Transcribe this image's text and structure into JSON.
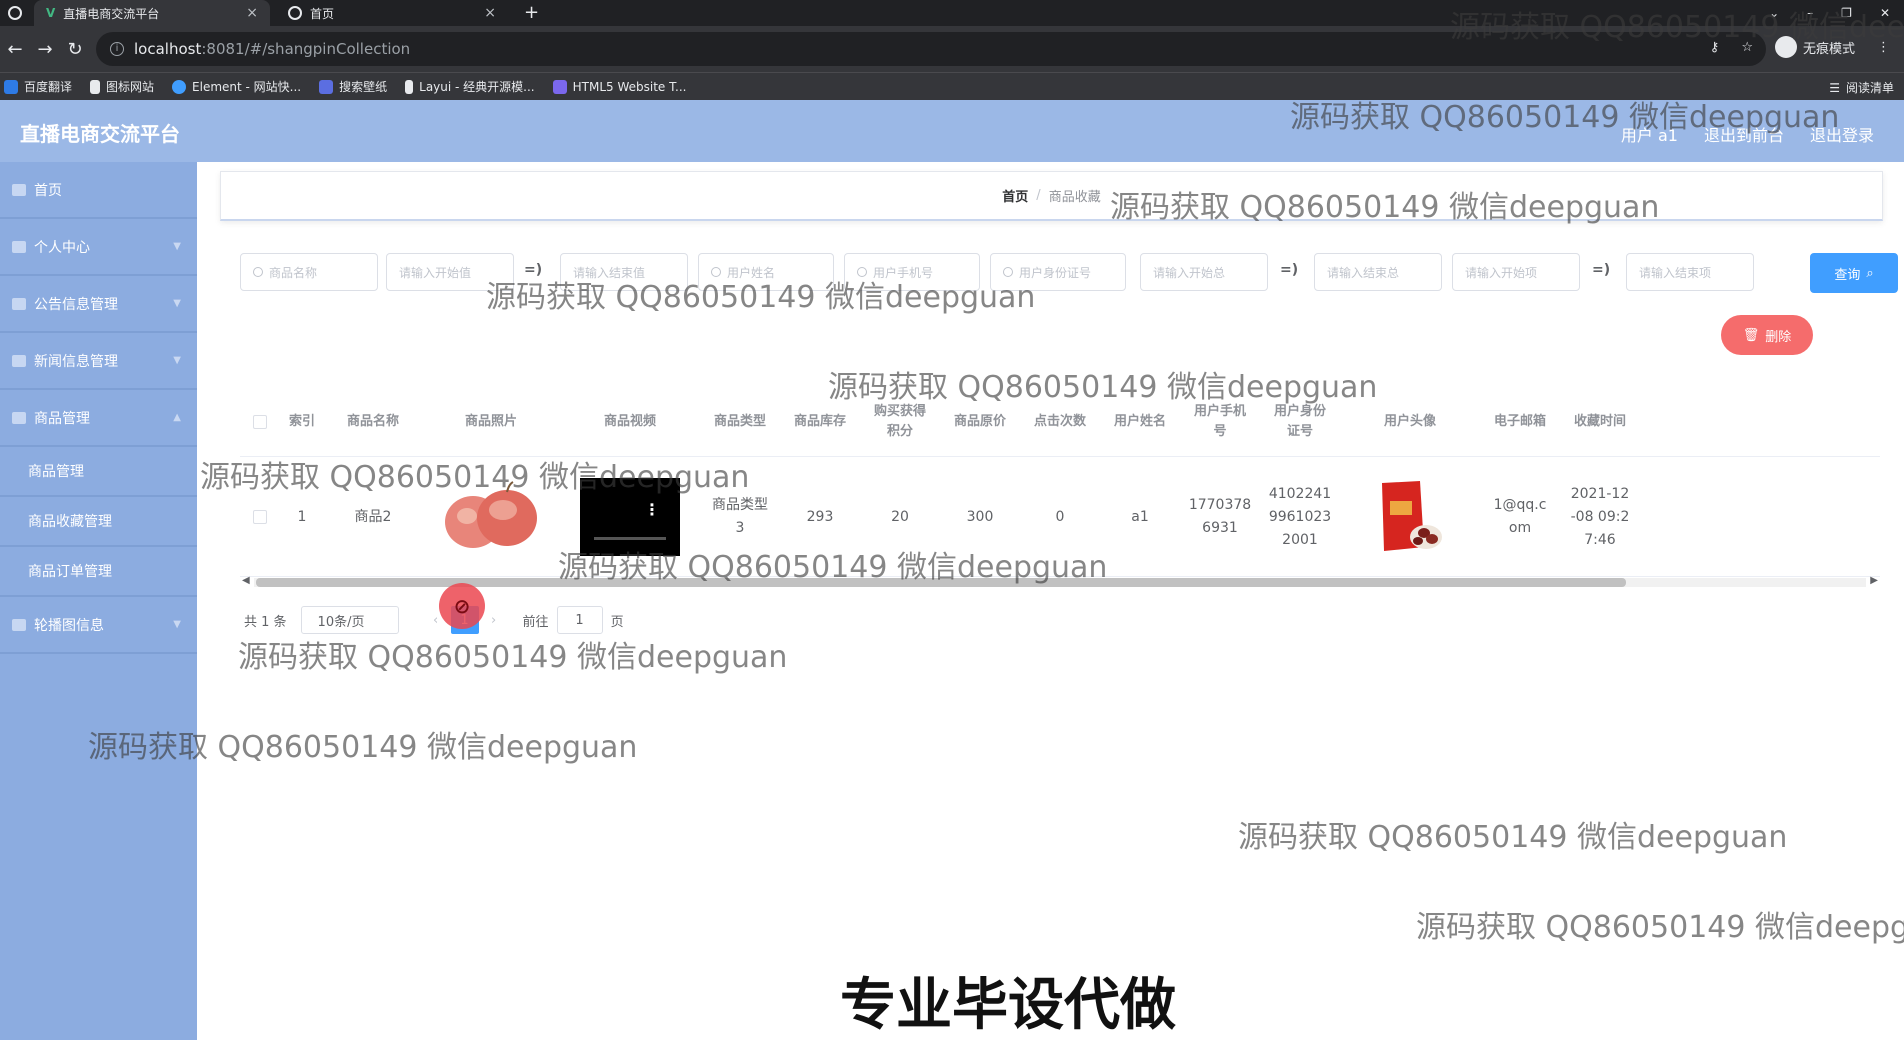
{
  "browser": {
    "tabs": [
      {
        "title": "直播电商交流平台",
        "close": "×"
      },
      {
        "title": "首页",
        "close": "×"
      }
    ],
    "new_tab": "+",
    "url_host": "localhost",
    "url_path": ":8081/#/shangpinCollection",
    "incognito_label": "无痕模式",
    "bookmarks": [
      "百度翻译",
      "图标网站",
      "Element - 网站快...",
      "搜索壁纸",
      "Layui - 经典开源模...",
      "HTML5 Website T..."
    ],
    "reading_list": "阅读清单"
  },
  "app": {
    "title": "直播电商交流平台",
    "header_links": [
      "用户 a1",
      "退出到前台",
      "退出登录"
    ]
  },
  "sidebar": {
    "items": [
      {
        "label": "首页"
      },
      {
        "label": "个人中心"
      },
      {
        "label": "公告信息管理"
      },
      {
        "label": "新闻信息管理"
      },
      {
        "label": "商品管理"
      }
    ],
    "sub_items": [
      {
        "label": "商品管理"
      },
      {
        "label": "商品收藏管理"
      },
      {
        "label": "商品订单管理"
      }
    ],
    "last_item": {
      "label": "轮播图信息"
    }
  },
  "breadcrumb": {
    "home": "首页",
    "sep": "/",
    "current": "商品收藏"
  },
  "search": {
    "placeholders": [
      "商品名称",
      "请输入开始值",
      "请输入结束值",
      "用户姓名",
      "用户手机号",
      "用户身份证号",
      "请输入开始总",
      "请输入结束总",
      "请输入开始项",
      "请输入结束项"
    ],
    "range_arrow": "=)",
    "query_label": "查询"
  },
  "actions": {
    "delete_label": "删除"
  },
  "table": {
    "headers": [
      "索引",
      "商品名称",
      "商品照片",
      "商品视频",
      "商品类型",
      "商品库存",
      "购买获得\n积分",
      "商品原价",
      "点击次数",
      "用户姓名",
      "用户手机\n号",
      "用户身份\n证号",
      "用户头像",
      "电子邮箱",
      "收藏时间"
    ],
    "rows": [
      {
        "index": "1",
        "name": "商品2",
        "type": "商品类型\n3",
        "stock": "293",
        "points": "20",
        "price": "300",
        "clicks": "0",
        "user_name": "a1",
        "phone": "1770378\n6931",
        "id_card": "4102241\n9961023\n2001",
        "email": "1@qq.c\nom",
        "time": "2021-12\n-08 09:2\n7:46"
      }
    ]
  },
  "pagination": {
    "total": "共 1 条",
    "page_size": "10条/页",
    "prev": "‹",
    "current": "1",
    "next": "›",
    "goto": "前往",
    "goto_value": "1",
    "page_unit": "页"
  },
  "watermarks": {
    "text": "源码获取 QQ86050149 微信deepguan",
    "promo": "专业毕设代做"
  },
  "colors": {
    "header_bg": "#9bb8e6",
    "sidebar_bg": "#8cace0",
    "primary": "#409eff",
    "danger": "#f56c6c"
  }
}
